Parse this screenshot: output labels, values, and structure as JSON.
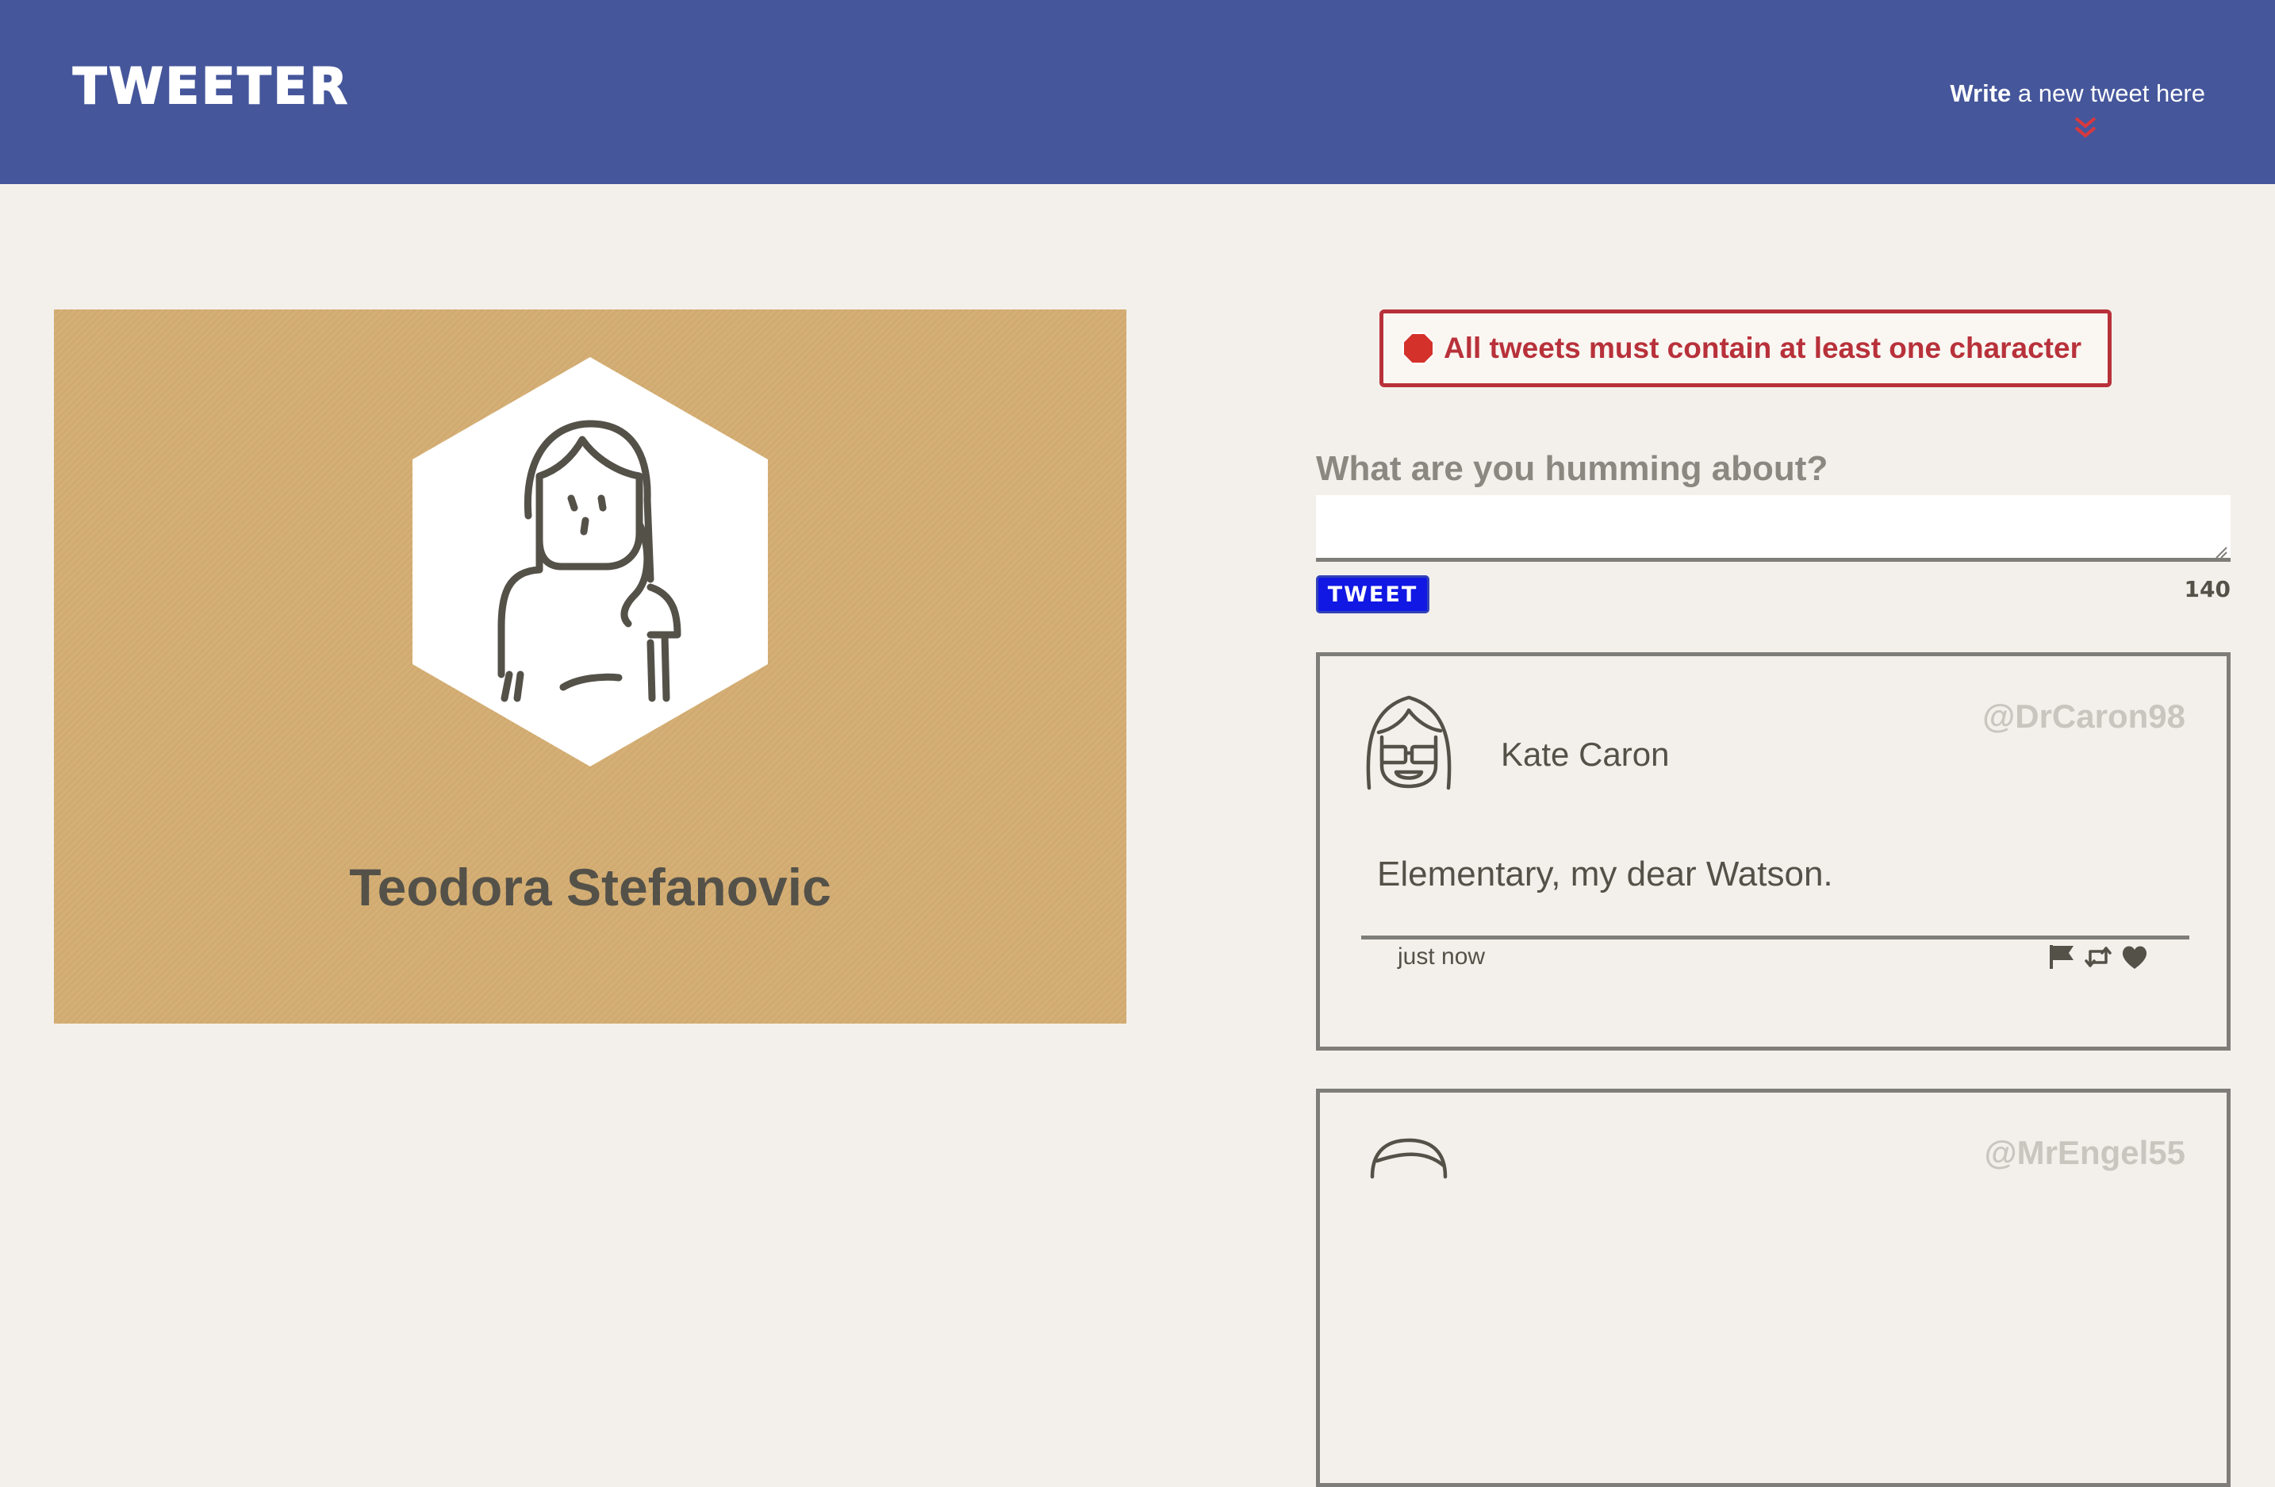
{
  "nav": {
    "logo": "TWEETER",
    "compose_toggle_bold": "Write",
    "compose_toggle_rest": " a new tweet here",
    "chevron_icon": "double-chevron-down-icon",
    "background": "#45569b",
    "accent": "#d9393e"
  },
  "profile": {
    "name": "Teodora Stefanovic",
    "avatar_icon": "user-avatar-icon",
    "background": "#d4ad72"
  },
  "compose": {
    "error": "All tweets must contain at least one character",
    "error_icon": "stop-sign-icon",
    "label": "What are you humming about?",
    "input_value": "",
    "button_label": "TWEET",
    "counter": "140",
    "button_color": "#1118e4",
    "error_color": "#b8313a"
  },
  "tweets": [
    {
      "name": "Kate Caron",
      "handle": "@DrCaron98",
      "text": "Elementary, my dear Watson.",
      "time": "just now",
      "avatar_icon": "user-avatar-glasses-icon",
      "actions": [
        "flag-icon",
        "retweet-icon",
        "heart-icon"
      ]
    },
    {
      "name": "",
      "handle": "@MrEngel55",
      "text": "",
      "time": "",
      "avatar_icon": "user-avatar-icon",
      "actions": [
        "flag-icon",
        "retweet-icon",
        "heart-icon"
      ]
    }
  ]
}
